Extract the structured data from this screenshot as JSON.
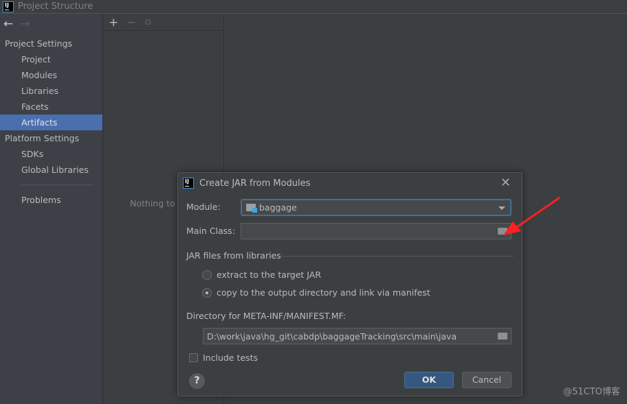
{
  "window": {
    "title": "Project Structure",
    "logo": "IJ"
  },
  "sidebar": {
    "sections": [
      {
        "label": "Project Settings",
        "items": [
          {
            "label": "Project"
          },
          {
            "label": "Modules"
          },
          {
            "label": "Libraries"
          },
          {
            "label": "Facets"
          },
          {
            "label": "Artifacts",
            "selected": true
          }
        ]
      },
      {
        "label": "Platform Settings",
        "items": [
          {
            "label": "SDKs"
          },
          {
            "label": "Global Libraries"
          }
        ]
      }
    ],
    "problems": "Problems"
  },
  "middle": {
    "empty_text": "Nothing to s"
  },
  "dialog": {
    "title": "Create JAR from Modules",
    "module_label": "Module:",
    "module_value": "baggage",
    "main_class_label": "Main Class:",
    "main_class_value": "",
    "jar_group": "JAR files from libraries",
    "radio_extract": "extract to the target JAR",
    "radio_copy": "copy to the output directory and link via manifest",
    "selected_radio": "copy",
    "dir_label": "Directory for META-INF/MANIFEST.MF:",
    "dir_value": "D:\\work\\java\\hg_git\\cabdp\\baggageTracking\\src\\main\\java",
    "include_tests": "Include tests",
    "include_tests_checked": false,
    "ok": "OK",
    "cancel": "Cancel",
    "help": "?"
  },
  "annotation": {
    "arrow_color": "#ff2020"
  },
  "watermark": "@51CTO博客",
  "colors": {
    "selection": "#4b6eaf",
    "ok_button": "#365880"
  }
}
